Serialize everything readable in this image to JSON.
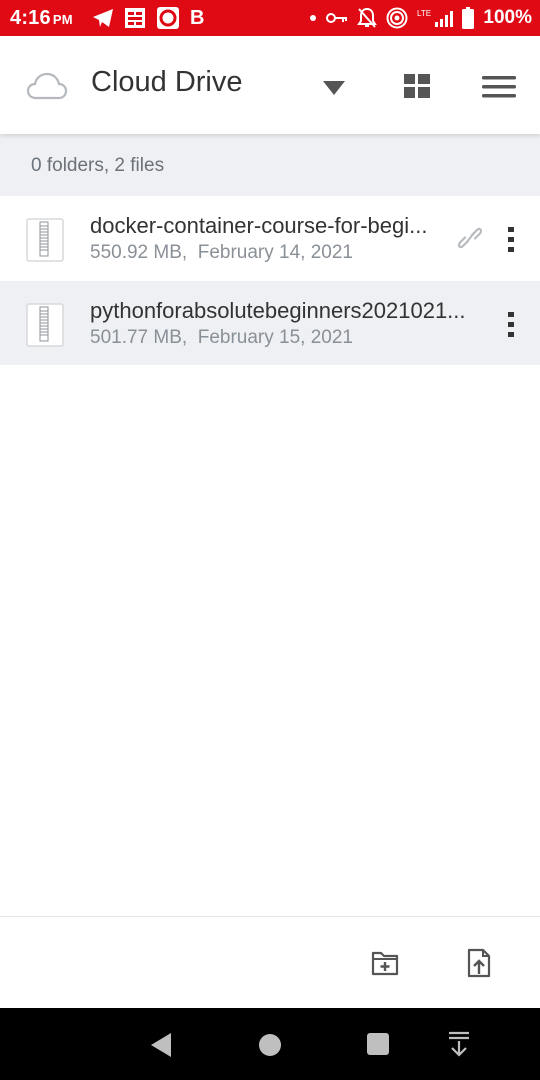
{
  "status_bar": {
    "time": "4:16",
    "ampm": "PM",
    "carrier_letter": "B",
    "network": "LTE",
    "battery": "100%",
    "icons": [
      "telegram-icon",
      "grid-app-icon",
      "circle-app-icon",
      "dot-icon",
      "vpn-key-icon",
      "notifications-off-icon",
      "hotspot-icon",
      "signal-icon",
      "battery-icon"
    ]
  },
  "app_bar": {
    "title": "Cloud Drive",
    "icons": [
      "cloud-icon",
      "dropdown-icon",
      "grid-view-icon",
      "hamburger-menu-icon"
    ]
  },
  "summary": {
    "text": "0 folders, 2 files"
  },
  "files": [
    {
      "name": "docker-container-course-for-begi...",
      "size": "550.92 MB,",
      "date": "February 14, 2021",
      "shared": true
    },
    {
      "name": "pythonforabsolutebeginners2021021...",
      "size": "501.77 MB,",
      "date": "February 15, 2021",
      "shared": false
    }
  ],
  "bottom_actions": {
    "icons": [
      "new-folder-icon",
      "upload-file-icon"
    ]
  },
  "nav_bar": {
    "icons": [
      "back-icon",
      "home-icon",
      "recents-icon",
      "notification-shade-icon"
    ]
  },
  "colors": {
    "status_bar": "#e00a15",
    "list_alt_bg": "#eef0f3",
    "text_primary": "#333333",
    "text_secondary": "#8a9097"
  }
}
